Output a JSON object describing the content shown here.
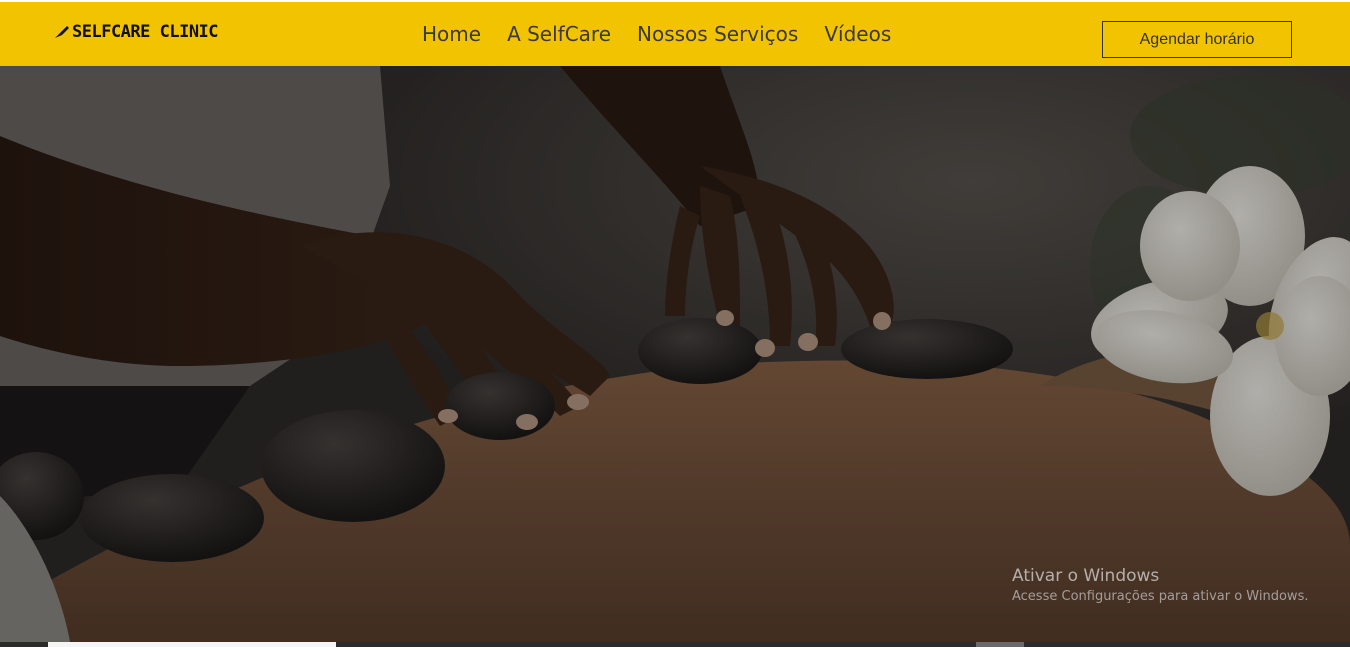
{
  "brand": {
    "name": "SELFCARE CLINIC",
    "icon": "brush-icon"
  },
  "nav": {
    "items": [
      {
        "label": "Home"
      },
      {
        "label": "A SelfCare"
      },
      {
        "label": "Nossos Serviços"
      },
      {
        "label": "Vídeos"
      }
    ],
    "cta_label": "Agendar horário"
  },
  "hero": {
    "image": "hot-stone-massage-photo"
  },
  "watermark": {
    "title": "Ativar o Windows",
    "subtitle": "Acesse Configurações para ativar o Windows."
  },
  "colors": {
    "header_bg": "#f2c300",
    "nav_text": "#3a3a3a",
    "brand_text": "#111111"
  }
}
